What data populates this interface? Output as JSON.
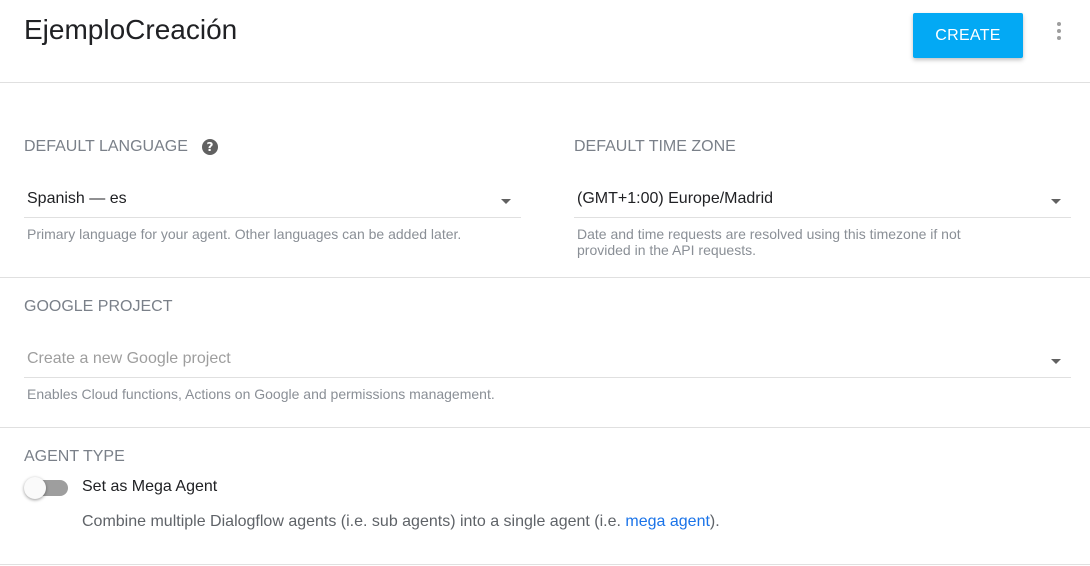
{
  "header": {
    "title": "EjemploCreación",
    "create_label": "CREATE"
  },
  "language": {
    "label": "DEFAULT LANGUAGE",
    "help_glyph": "?",
    "value": "Spanish — es",
    "hint": "Primary language for your agent. Other languages can be added later."
  },
  "timezone": {
    "label": "DEFAULT TIME ZONE",
    "value": "(GMT+1:00) Europe/Madrid",
    "hint_line1": "Date and time requests are resolved using this timezone if not",
    "hint_line2": "provided in the API requests."
  },
  "google_project": {
    "label": "GOOGLE PROJECT",
    "placeholder": "Create a new Google project",
    "hint": "Enables Cloud functions, Actions on Google and permissions management."
  },
  "agent_type": {
    "label": "AGENT TYPE",
    "toggle_label": "Set as Mega Agent",
    "toggle_on": false,
    "desc_before": "Combine multiple Dialogflow agents (i.e. sub agents) into a single agent (i.e. ",
    "desc_link": "mega agent",
    "desc_after": ")."
  },
  "colors": {
    "accent": "#03a9f4",
    "link": "#1a73e8",
    "label": "#7a8089"
  }
}
